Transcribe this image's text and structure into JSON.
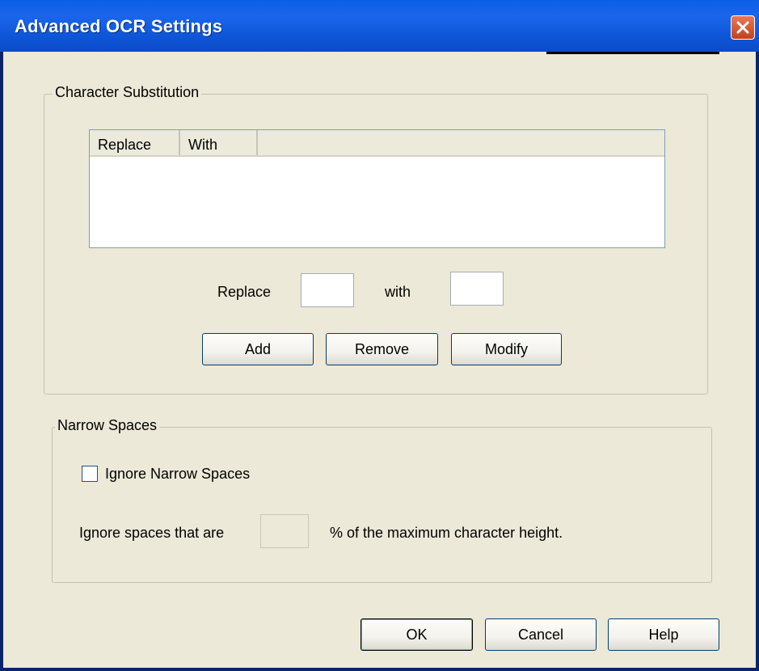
{
  "window": {
    "title": "Advanced OCR Settings"
  },
  "character_substitution": {
    "legend": "Character Substitution",
    "list_columns": [
      "Replace",
      "With"
    ],
    "rows": [],
    "replace_label": "Replace",
    "replace_value": "",
    "with_label": "with",
    "with_value": "",
    "buttons": {
      "add": "Add",
      "remove": "Remove",
      "modify": "Modify"
    }
  },
  "narrow_spaces": {
    "legend": "Narrow Spaces",
    "checkbox_label": "Ignore Narrow Spaces",
    "checked": false,
    "prefix_label": "Ignore spaces that are",
    "percent_value": "",
    "suffix_label": "% of the maximum character height."
  },
  "footer": {
    "ok": "OK",
    "cancel": "Cancel",
    "help": "Help"
  },
  "colors": {
    "titlebar": "#0a5ee6",
    "close": "#d9532e",
    "dialog_bg": "#ece9d8"
  },
  "icons": {
    "close": "close-icon"
  }
}
